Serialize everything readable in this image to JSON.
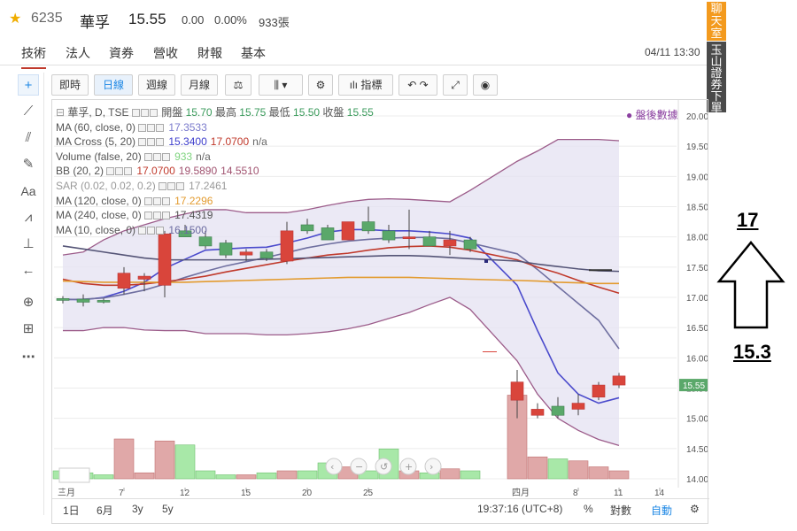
{
  "header": {
    "code": "6235",
    "name": "華孚",
    "price": "15.55",
    "change": "0.00",
    "change_pct": "0.00%",
    "volume": "933張"
  },
  "tabs": [
    "技術",
    "法人",
    "資券",
    "營收",
    "財報",
    "基本"
  ],
  "active_tab": "技術",
  "timestamp": "04/11 13:30",
  "side_banner": {
    "top": "聊天室",
    "bottom": "玉山證券下單"
  },
  "toolbar": {
    "buttons": [
      "即時",
      "日線",
      "週線",
      "月線"
    ],
    "active": "日線",
    "indicators_label": "指標"
  },
  "legend": {
    "main": "華孚, D, TSE",
    "ohlc": {
      "open_label": "開盤",
      "open": "15.70",
      "high_label": "最高",
      "high": "15.75",
      "low_label": "最低",
      "low": "15.50",
      "close_label": "收盤",
      "close": "15.55"
    },
    "rows": [
      {
        "label": "MA (60, close, 0)",
        "values": [
          "17.3533"
        ],
        "colors": [
          "#7a7acc"
        ]
      },
      {
        "label": "MA Cross (5, 20)",
        "values": [
          "15.3400",
          "17.0700",
          "n/a"
        ],
        "colors": [
          "#3d3dcc",
          "#c0392b",
          "#666"
        ]
      },
      {
        "label": "Volume (false, 20)",
        "values": [
          "933",
          "n/a"
        ],
        "colors": [
          "#7fd47f",
          "#666"
        ]
      },
      {
        "label": "BB (20, 2)",
        "values": [
          "17.0700",
          "19.5890",
          "14.5510"
        ],
        "colors": [
          "#c0392b",
          "#a0526f",
          "#a0526f"
        ]
      },
      {
        "label": "SAR (0.02, 0.02, 0.2)",
        "values": [
          "17.2461"
        ],
        "colors": [
          "#999"
        ]
      },
      {
        "label": "MA (120, close, 0)",
        "values": [
          "17.2296"
        ],
        "colors": [
          "#e39b2f"
        ]
      },
      {
        "label": "MA (240, close, 0)",
        "values": [
          "17.4319"
        ],
        "colors": [
          "#555"
        ]
      },
      {
        "label": "MA (10, close, 0)",
        "values": [
          "16.1500"
        ],
        "colors": [
          "#6a6aa0"
        ]
      }
    ],
    "after_hours": "盤後數據"
  },
  "bottom_bar": {
    "ranges": [
      "1日",
      "6月",
      "3y",
      "5y"
    ],
    "clock": "19:37:16 (UTC+8)",
    "pct": "%",
    "log": "對數",
    "auto": "自動"
  },
  "chart_data": {
    "type": "candlestick",
    "price_axis": {
      "min": 14.0,
      "max": 20.0,
      "ticks": [
        "20.00",
        "19.50",
        "19.00",
        "18.50",
        "18.00",
        "17.50",
        "17.00",
        "16.50",
        "16.00",
        "15.50",
        "15.00",
        "14.50",
        "14.00"
      ],
      "last_label": "15.55"
    },
    "x_ticks": [
      "三月",
      "7",
      "12",
      "15",
      "20",
      "25",
      "四月",
      "8",
      "11",
      "14"
    ],
    "candles": [
      {
        "o": 16.98,
        "h": 17.02,
        "l": 16.9,
        "c": 16.95
      },
      {
        "o": 16.97,
        "h": 17.05,
        "l": 16.85,
        "c": 16.92
      },
      {
        "o": 16.95,
        "h": 16.98,
        "l": 16.9,
        "c": 16.93
      },
      {
        "o": 17.15,
        "h": 17.5,
        "l": 17.05,
        "c": 17.4
      },
      {
        "o": 17.3,
        "h": 17.4,
        "l": 17.1,
        "c": 17.35
      },
      {
        "o": 17.2,
        "h": 18.1,
        "l": 17.0,
        "c": 18.05
      },
      {
        "o": 18.1,
        "h": 18.2,
        "l": 18.0,
        "c": 18.0
      },
      {
        "o": 18.0,
        "h": 18.1,
        "l": 17.8,
        "c": 17.85
      },
      {
        "o": 17.9,
        "h": 17.95,
        "l": 17.65,
        "c": 17.7
      },
      {
        "o": 17.7,
        "h": 17.8,
        "l": 17.6,
        "c": 17.75
      },
      {
        "o": 17.75,
        "h": 17.8,
        "l": 17.6,
        "c": 17.65
      },
      {
        "o": 17.6,
        "h": 18.25,
        "l": 17.55,
        "c": 18.1
      },
      {
        "o": 18.2,
        "h": 18.3,
        "l": 18.05,
        "c": 18.1
      },
      {
        "o": 18.15,
        "h": 18.2,
        "l": 17.95,
        "c": 17.95
      },
      {
        "o": 17.95,
        "h": 18.25,
        "l": 17.95,
        "c": 18.25
      },
      {
        "o": 18.25,
        "h": 18.5,
        "l": 18.05,
        "c": 18.1
      },
      {
        "o": 18.1,
        "h": 18.2,
        "l": 17.9,
        "c": 17.95
      },
      {
        "o": 18.0,
        "h": 18.45,
        "l": 17.8,
        "c": 18.0
      },
      {
        "o": 18.0,
        "h": 18.1,
        "l": 17.85,
        "c": 17.85
      },
      {
        "o": 17.85,
        "h": 18.1,
        "l": 17.7,
        "c": 17.95
      },
      {
        "o": 17.95,
        "h": 18.0,
        "l": 17.75,
        "c": 17.8
      },
      {
        "o": 15.3,
        "h": 15.8,
        "l": 15.0,
        "c": 15.6
      },
      {
        "o": 15.05,
        "h": 15.25,
        "l": 15.0,
        "c": 15.15
      },
      {
        "o": 15.2,
        "h": 15.35,
        "l": 15.0,
        "c": 15.05
      },
      {
        "o": 15.15,
        "h": 15.4,
        "l": 15.05,
        "c": 15.25
      },
      {
        "o": 15.35,
        "h": 15.6,
        "l": 15.3,
        "c": 15.55
      },
      {
        "o": 15.55,
        "h": 15.75,
        "l": 15.5,
        "c": 15.7
      }
    ],
    "volumes": [
      0.2,
      0.15,
      0.1,
      1.0,
      0.15,
      0.95,
      0.85,
      0.2,
      0.1,
      0.1,
      0.15,
      0.2,
      0.2,
      0.4,
      0.3,
      0.2,
      0.75,
      0.2,
      0.15,
      0.25,
      0.2,
      2.1,
      0.55,
      0.5,
      0.45,
      0.3,
      0.2
    ],
    "series": [
      {
        "name": "MA (10, close, 0)",
        "color": "#4a4acc",
        "values": [
          16.97,
          16.96,
          17.0,
          17.1,
          17.25,
          17.48,
          17.63,
          17.78,
          17.8,
          17.82,
          17.83,
          17.9,
          17.98,
          18.08,
          18.12,
          18.12,
          18.1,
          18.1,
          18.08,
          18.05,
          17.98,
          17.2,
          16.45,
          15.75,
          15.4,
          15.25,
          15.34
        ]
      },
      {
        "name": "MA (60, close, 0)",
        "color": "#6f6fa0",
        "values": [
          16.96,
          16.97,
          16.99,
          17.05,
          17.12,
          17.22,
          17.33,
          17.43,
          17.52,
          17.59,
          17.66,
          17.74,
          17.82,
          17.88,
          17.93,
          17.96,
          17.98,
          17.99,
          17.99,
          17.97,
          17.9,
          17.72,
          17.46,
          17.18,
          16.9,
          16.62,
          16.15
        ]
      },
      {
        "name": "MA Cross slow",
        "color": "#c0392b",
        "values": [
          17.3,
          17.23,
          17.2,
          17.2,
          17.22,
          17.26,
          17.3,
          17.35,
          17.42,
          17.48,
          17.54,
          17.6,
          17.65,
          17.7,
          17.73,
          17.78,
          17.82,
          17.84,
          17.85,
          17.83,
          17.78,
          17.62,
          17.5,
          17.4,
          17.28,
          17.17,
          17.07
        ]
      },
      {
        "name": "MA (240, close, 0)",
        "color": "#555577",
        "values": [
          17.85,
          17.8,
          17.75,
          17.7,
          17.65,
          17.62,
          17.62,
          17.62,
          17.62,
          17.62,
          17.63,
          17.64,
          17.65,
          17.66,
          17.67,
          17.68,
          17.69,
          17.69,
          17.68,
          17.66,
          17.64,
          17.6,
          17.55,
          17.51,
          17.47,
          17.44,
          17.43
        ]
      },
      {
        "name": "MA (120, close, 0)",
        "color": "#e39b2f",
        "values": [
          17.27,
          17.26,
          17.25,
          17.25,
          17.25,
          17.25,
          17.25,
          17.26,
          17.27,
          17.28,
          17.29,
          17.3,
          17.31,
          17.32,
          17.33,
          17.33,
          17.33,
          17.33,
          17.32,
          17.31,
          17.3,
          17.28,
          17.27,
          17.25,
          17.24,
          17.23,
          17.23
        ]
      }
    ],
    "bands": {
      "upper": [
        17.7,
        17.75,
        17.95,
        18.1,
        18.2,
        18.3,
        18.38,
        18.45,
        18.45,
        18.4,
        18.4,
        18.4,
        18.45,
        18.52,
        18.58,
        18.62,
        18.63,
        18.62,
        18.6,
        18.58,
        18.77,
        19.25,
        19.42,
        19.61,
        19.61,
        19.61,
        19.59
      ],
      "lower": [
        16.45,
        16.45,
        16.5,
        16.5,
        16.46,
        16.45,
        16.45,
        16.4,
        16.4,
        16.4,
        16.38,
        16.38,
        16.4,
        16.43,
        16.48,
        16.55,
        16.65,
        16.75,
        16.88,
        17.0,
        16.8,
        15.95,
        15.4,
        15.0,
        14.8,
        14.65,
        14.55
      ]
    },
    "sar_marker": 17.6,
    "after_hours_dash": 17.45,
    "red_dash": 16.1
  },
  "annotation": {
    "top": "17",
    "bottom": "15.3"
  }
}
